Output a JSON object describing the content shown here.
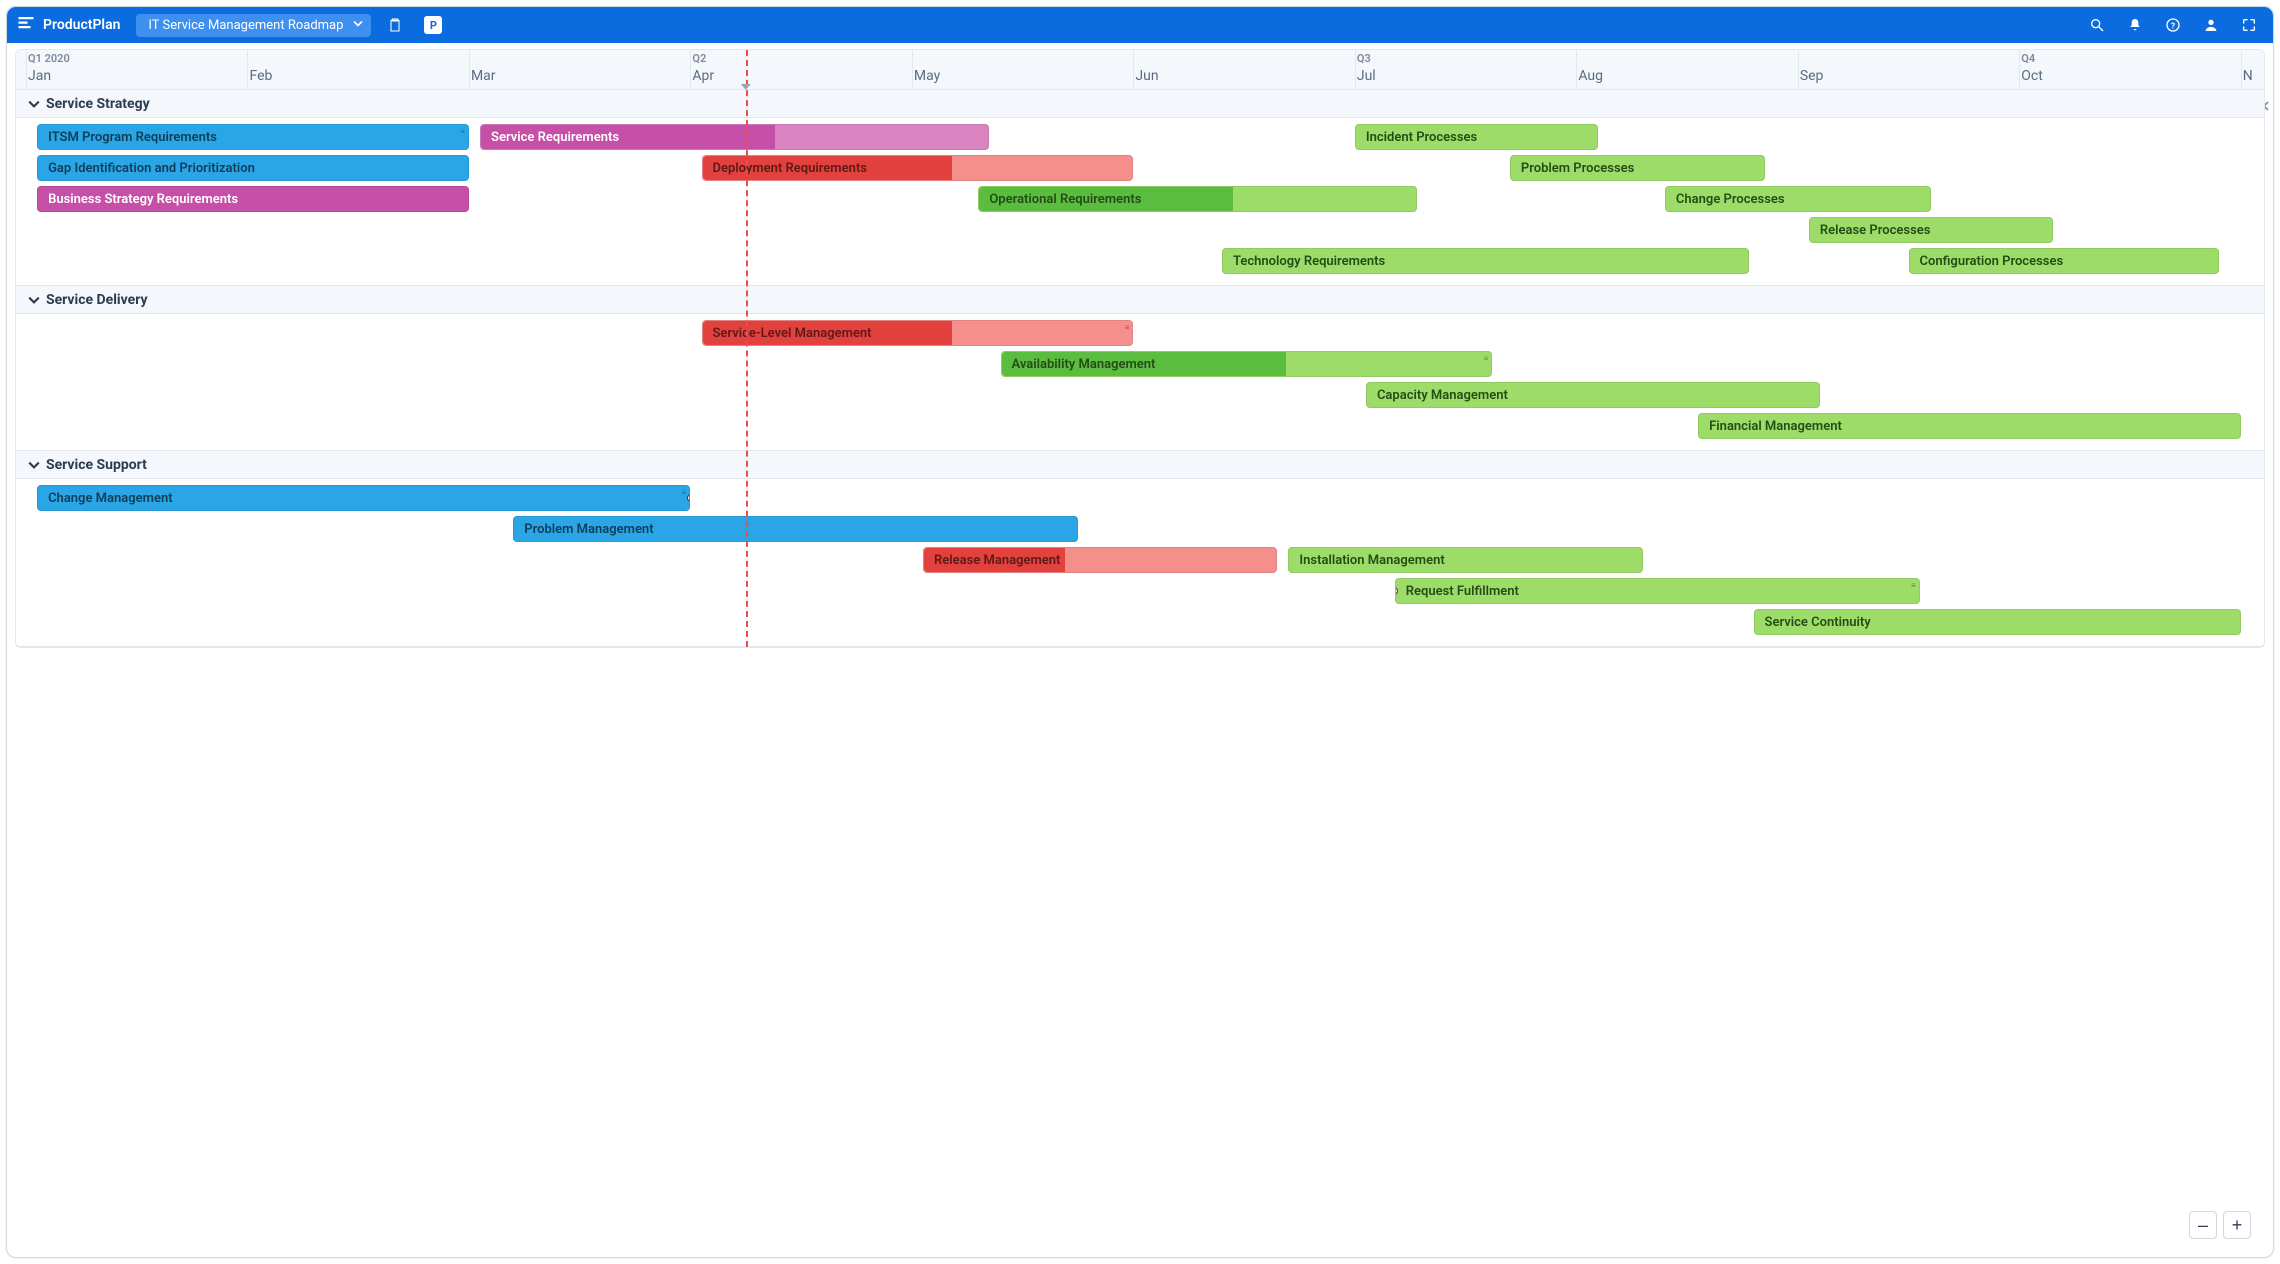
{
  "brand": "ProductPlan",
  "roadmap_name": "IT Service Management Roadmap",
  "zoom": {
    "out": "–",
    "in": "+"
  },
  "timeline": {
    "quarters": [
      {
        "label": "Q1 2020",
        "month": "Jan"
      },
      {
        "label": "Q2",
        "month": "Apr"
      },
      {
        "label": "Q3",
        "month": "Jul"
      },
      {
        "label": "Q4",
        "month": "Oct"
      }
    ],
    "months": [
      {
        "label": "Jan",
        "idx": 0
      },
      {
        "label": "Feb",
        "idx": 1
      },
      {
        "label": "Mar",
        "idx": 2
      },
      {
        "label": "Apr",
        "idx": 3
      },
      {
        "label": "May",
        "idx": 4
      },
      {
        "label": "Jun",
        "idx": 5
      },
      {
        "label": "Jul",
        "idx": 6
      },
      {
        "label": "Aug",
        "idx": 7
      },
      {
        "label": "Sep",
        "idx": 8
      },
      {
        "label": "Oct",
        "idx": 9
      },
      {
        "label": "N",
        "idx": 10
      }
    ]
  },
  "colors": {
    "blue": {
      "fill": "#2aa6e6",
      "inner": "#2aa6e6",
      "text": "#0f3e5b"
    },
    "pinkA": {
      "fill": "#d984c0",
      "inner": "#c64fa7",
      "text": "#ffffff"
    },
    "pinkB": {
      "fill": "#d984c0",
      "inner": "#c64fa7",
      "text": "#ffffff"
    },
    "red": {
      "fill": "#f58f8c",
      "inner": "#e3413e",
      "text": "#5c1a19"
    },
    "green": {
      "fill": "#9edc6a",
      "inner": "#5bbd3f",
      "text": "#234d14"
    }
  },
  "lanes": [
    {
      "title": "Service Strategy",
      "rows": 5,
      "bars": [
        {
          "label": "ITSM Program Requirements",
          "color": "blue",
          "row": 0,
          "start": 0.05,
          "end": 2.0,
          "progress": 1.0,
          "grip": true
        },
        {
          "label": "Service Requirements",
          "color": "pinkA",
          "row": 0,
          "start": 2.05,
          "end": 4.35,
          "progress": 0.58,
          "text": "#ffffff"
        },
        {
          "label": "Incident Processes",
          "color": "green",
          "row": 0,
          "start": 6.0,
          "end": 7.1,
          "progress": 0
        },
        {
          "label": "Gap Identification and Prioritization",
          "color": "blue",
          "row": 1,
          "start": 0.05,
          "end": 2.0,
          "progress": 1.0
        },
        {
          "label": "Deployment Requirements",
          "color": "red",
          "row": 1,
          "start": 3.05,
          "end": 5.0,
          "progress": 0.58
        },
        {
          "label": "Problem Processes",
          "color": "green",
          "row": 1,
          "start": 6.7,
          "end": 7.85,
          "progress": 0
        },
        {
          "label": "Business Strategy Requirements",
          "color": "pinkB",
          "row": 2,
          "start": 0.05,
          "end": 2.0,
          "progress": 1.0,
          "text": "#ffffff"
        },
        {
          "label": "Operational Requirements",
          "color": "green",
          "row": 2,
          "start": 4.3,
          "end": 6.28,
          "progress": 0.58
        },
        {
          "label": "Change Processes",
          "color": "green",
          "row": 2,
          "start": 7.4,
          "end": 8.6,
          "progress": 0
        },
        {
          "label": "Release Processes",
          "color": "green",
          "row": 3,
          "start": 8.05,
          "end": 9.15,
          "progress": 0
        },
        {
          "label": "Technology Requirements",
          "color": "green",
          "row": 4,
          "start": 5.4,
          "end": 7.78,
          "progress": 0
        },
        {
          "label": "Configuration Processes",
          "color": "green",
          "row": 4,
          "start": 8.5,
          "end": 9.9,
          "progress": 0
        }
      ]
    },
    {
      "title": "Service Delivery",
      "rows": 4,
      "bars": [
        {
          "label": "Service-Level Management",
          "color": "red",
          "row": 0,
          "start": 3.05,
          "end": 5.0,
          "progress": 0.58,
          "grip": true
        },
        {
          "label": "Availability Management",
          "color": "green",
          "row": 1,
          "start": 4.4,
          "end": 6.62,
          "progress": 0.58,
          "grip": true
        },
        {
          "label": "Capacity Management",
          "color": "green",
          "row": 2,
          "start": 6.05,
          "end": 8.1,
          "progress": 0
        },
        {
          "label": "Financial Management",
          "color": "green",
          "row": 3,
          "start": 7.55,
          "end": 10.0,
          "progress": 0
        }
      ]
    },
    {
      "title": "Service Support",
      "rows": 5,
      "bars": [
        {
          "label": "Change Management",
          "color": "blue",
          "row": 0,
          "start": 0.05,
          "end": 3.0,
          "progress": 1.0,
          "grip": true,
          "linkRight": true
        },
        {
          "label": "Problem Management",
          "color": "blue",
          "row": 1,
          "start": 2.2,
          "end": 4.75,
          "progress": 1.0
        },
        {
          "label": "Release Management",
          "color": "red",
          "row": 2,
          "start": 4.05,
          "end": 5.65,
          "progress": 0.4
        },
        {
          "label": "Installation Management",
          "color": "green",
          "row": 2,
          "start": 5.7,
          "end": 7.3,
          "progress": 0
        },
        {
          "label": "Request Fulfillment",
          "color": "green",
          "row": 3,
          "start": 6.18,
          "end": 8.55,
          "progress": 0,
          "grip": true,
          "linkLeft": true
        },
        {
          "label": "Service Continuity",
          "color": "green",
          "row": 4,
          "start": 7.8,
          "end": 10.0,
          "progress": 0
        }
      ]
    }
  ],
  "today_month_idx": 3.25
}
